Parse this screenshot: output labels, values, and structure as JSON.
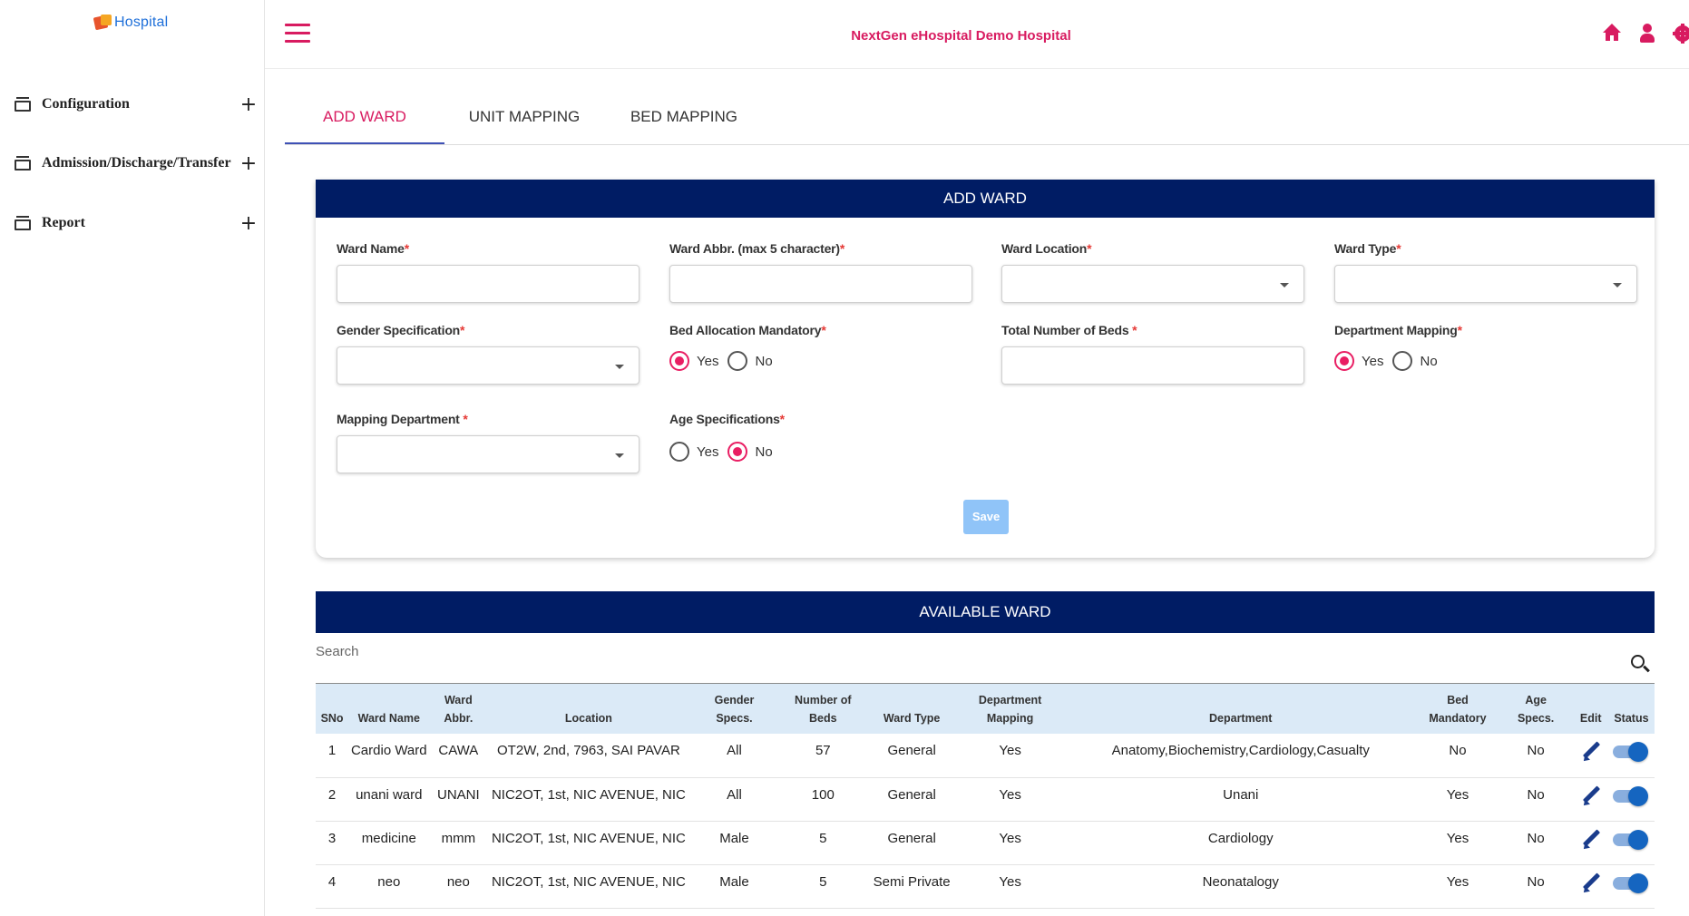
{
  "app": {
    "logo_text": "Hospital",
    "hospital_name": "NextGen eHospital Demo Hospital",
    "accent_color": "#d81b60",
    "header_color": "#001c64"
  },
  "sidebar": {
    "items": [
      {
        "label": "Configuration",
        "icon": "archive-icon",
        "expand": "+"
      },
      {
        "label": "Admission/Discharge/Transfer",
        "icon": "archive-icon",
        "expand": "+"
      },
      {
        "label": "Report",
        "icon": "archive-icon",
        "expand": "+"
      }
    ]
  },
  "header": {
    "icons": [
      "menu-icon",
      "home-icon",
      "user-icon",
      "gear-icon"
    ]
  },
  "tabs": [
    {
      "label": "ADD WARD",
      "active": true
    },
    {
      "label": "UNIT MAPPING",
      "active": false
    },
    {
      "label": "BED MAPPING",
      "active": false
    }
  ],
  "form": {
    "title": "ADD WARD",
    "ward_name": {
      "label": "Ward Name",
      "required": "*",
      "value": ""
    },
    "ward_abbr": {
      "label": "Ward Abbr. (max 5 character)",
      "required": "*",
      "value": ""
    },
    "ward_location": {
      "label": "Ward Location",
      "required": "*",
      "value": ""
    },
    "ward_type": {
      "label": "Ward Type",
      "required": "*",
      "value": ""
    },
    "gender_spec": {
      "label": "Gender Specification",
      "required": "*",
      "value": ""
    },
    "bed_allocation": {
      "label": "Bed Allocation Mandatory",
      "required": "*",
      "yes": "Yes",
      "no": "No",
      "selected": "Yes"
    },
    "total_beds": {
      "label": "Total Number of Beds ",
      "required": "*",
      "value": ""
    },
    "dept_mapping": {
      "label": "Department Mapping",
      "required": "*",
      "yes": "Yes",
      "no": "No",
      "selected": "Yes"
    },
    "mapping_dept": {
      "label": "Mapping Department ",
      "required": "*",
      "value": ""
    },
    "age_spec": {
      "label": "Age Specifications",
      "required": "*",
      "yes": "Yes",
      "no": "No",
      "selected": "No"
    },
    "save_label": "Save"
  },
  "available": {
    "title": "AVAILABLE WARD",
    "search_placeholder": "Search",
    "columns": [
      "SNo",
      "Ward Name",
      "Ward\nAbbr.",
      "Location",
      "Gender\nSpecs.",
      "Number of\nBeds",
      "Ward Type",
      "Department\nMapping",
      "Department",
      "Bed\nMandatory",
      "Age\nSpecs.",
      "Edit",
      "Status"
    ],
    "rows": [
      {
        "sno": "1",
        "name": "Cardio Ward",
        "abbr": "CAWA",
        "location": "OT2W, 2nd, 7963, SAI PAVAR",
        "gender": "All",
        "beds": "57",
        "type": "General",
        "dept_map": "Yes",
        "department": "Anatomy,Biochemistry,Cardiology,Casualty",
        "bed_mand": "No",
        "age": "No",
        "status_on": true
      },
      {
        "sno": "2",
        "name": "unani ward",
        "abbr": "UNANI",
        "location": "NIC2OT, 1st, NIC AVENUE, NIC",
        "gender": "All",
        "beds": "100",
        "type": "General",
        "dept_map": "Yes",
        "department": "Unani",
        "bed_mand": "Yes",
        "age": "No",
        "status_on": true
      },
      {
        "sno": "3",
        "name": "medicine",
        "abbr": "mmm",
        "location": "NIC2OT, 1st, NIC AVENUE, NIC",
        "gender": "Male",
        "beds": "5",
        "type": "General",
        "dept_map": "Yes",
        "department": "Cardiology",
        "bed_mand": "Yes",
        "age": "No",
        "status_on": true
      },
      {
        "sno": "4",
        "name": "neo",
        "abbr": "neo",
        "location": "NIC2OT, 1st, NIC AVENUE, NIC",
        "gender": "Male",
        "beds": "5",
        "type": "Semi Private",
        "dept_map": "Yes",
        "department": "Neonatalogy",
        "bed_mand": "Yes",
        "age": "No",
        "status_on": true
      }
    ]
  }
}
